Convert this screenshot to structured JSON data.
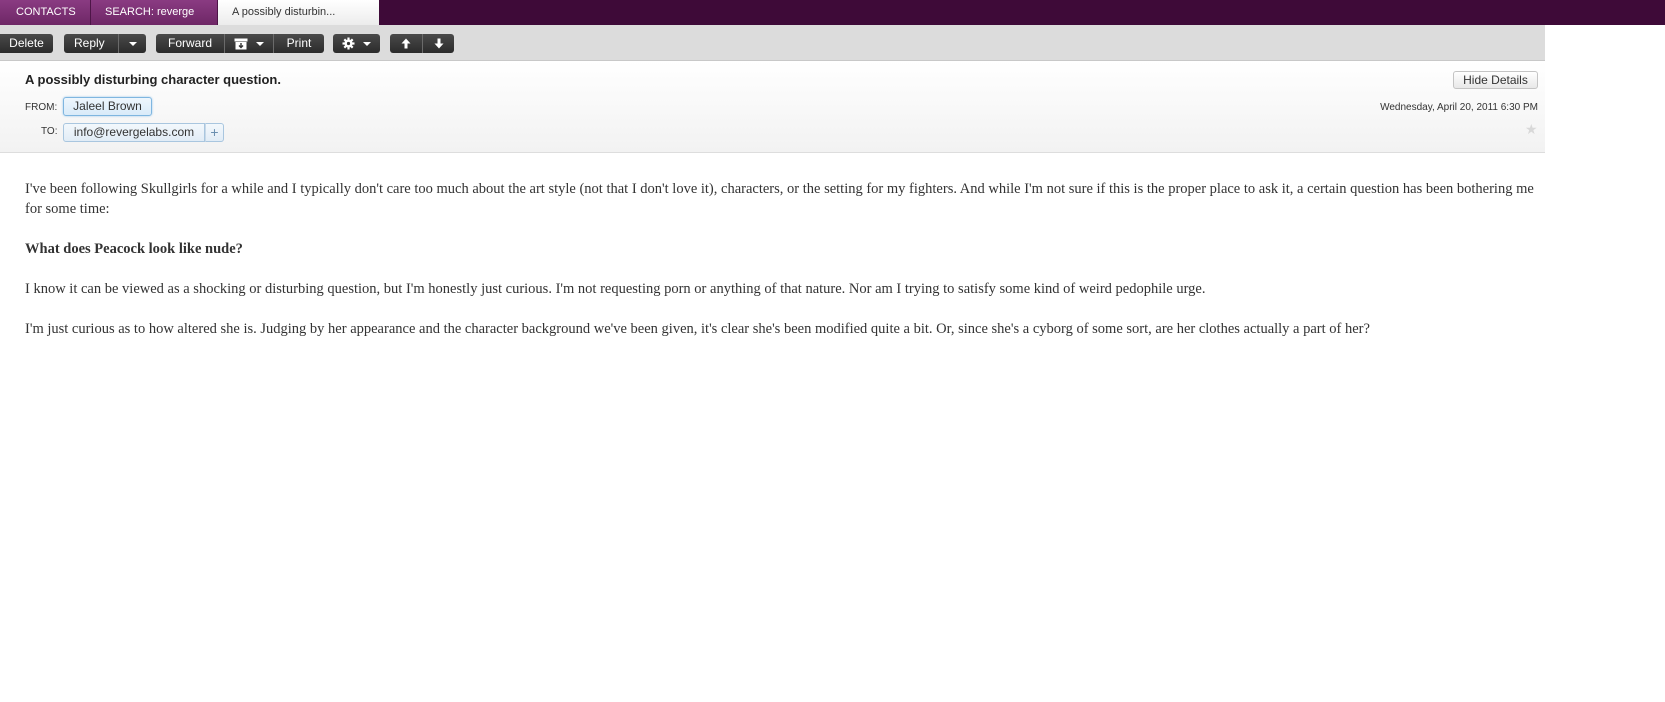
{
  "tabs": [
    {
      "label": "CONTACTS"
    },
    {
      "label": "SEARCH: reverge"
    },
    {
      "label": "A possibly disturbin..."
    }
  ],
  "toolbar": {
    "delete_label": "Delete",
    "reply_label": "Reply",
    "forward_label": "Forward",
    "print_label": "Print"
  },
  "icons": {
    "archive": "archive-icon",
    "settings": "gear-icon",
    "up": "arrow-up-icon",
    "down": "arrow-down-icon",
    "star": "star-icon"
  },
  "message": {
    "subject": "A possibly disturbing character question.",
    "hide_details_label": "Hide Details",
    "from_label": "FROM:",
    "from_name": "Jaleel Brown",
    "to_label": "TO:",
    "to_address": "info@revergelabs.com",
    "add_recipient_label": "+",
    "date": "Wednesday, April 20, 2011 6:30 PM",
    "body": [
      "I've been following Skullgirls for a while and I typically don't care too much about the art style (not that I don't love it), characters, or the setting for my fighters. And while I'm not sure if this is the proper place to ask it, a certain question has been bothering me for some time:",
      "What does Peacock look like nude?",
      "I know it can be viewed as a shocking or disturbing question, but I'm honestly just curious. I'm not requesting porn or anything of that nature. Nor am I trying to satisfy some kind of weird pedophile urge.",
      "I'm just curious as to how altered she is. Judging by her appearance and the character background we've been given, it's clear she's been modified quite a bit. Or, since she's a cyborg of some sort, are her clothes actually a part of her?"
    ]
  },
  "colors": {
    "tabbar_bg": "#3e0a38",
    "tab_bg": "#7a2f72",
    "active_tab_bg": "#f4f4f4",
    "toolbar_bg": "#dcdcdc",
    "button_bg": "#333333",
    "chip_border": "#7fb6e0"
  }
}
